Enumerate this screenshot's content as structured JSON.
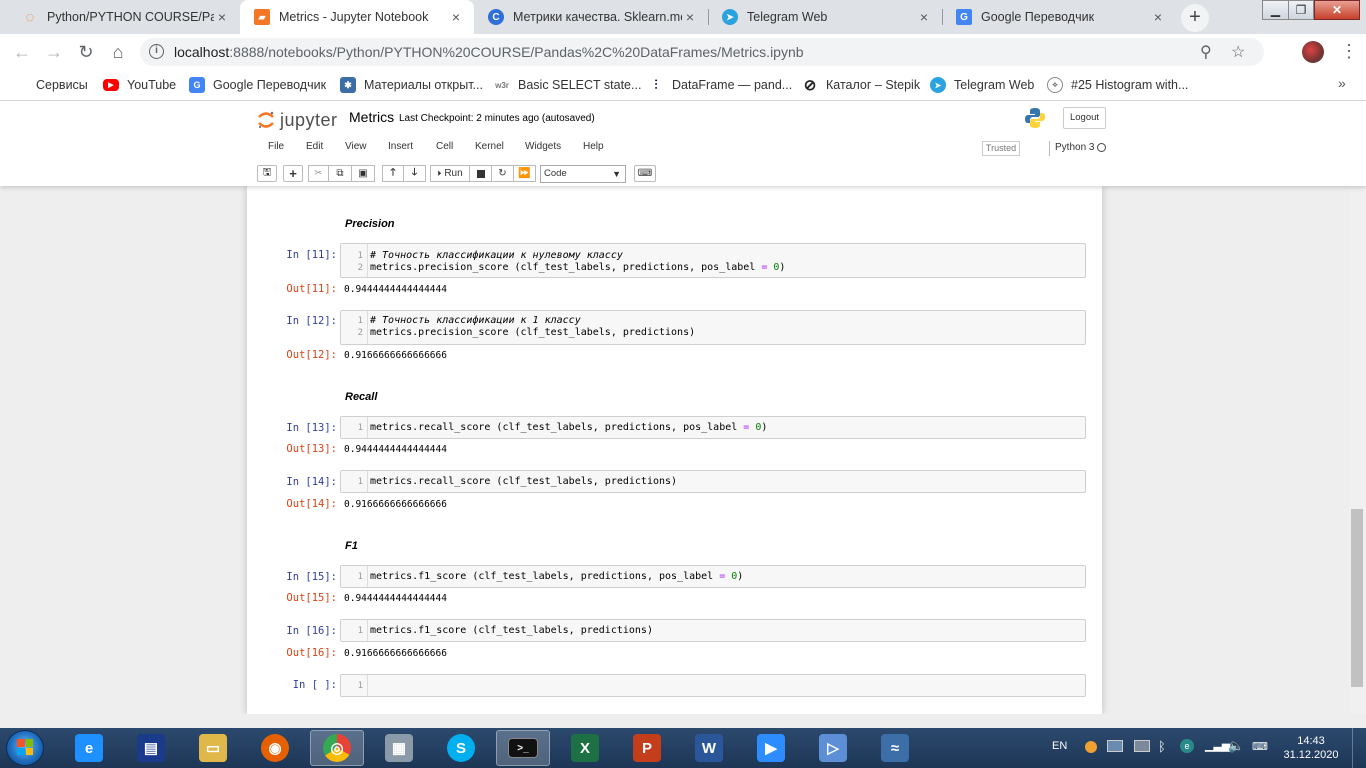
{
  "browser": {
    "tabs": [
      {
        "title": "Python/PYTHON COURSE/Panda",
        "close": "×",
        "fav_color": "#f37726",
        "fav_glyph": "◌"
      },
      {
        "title": "Metrics - Jupyter Notebook",
        "close": "×",
        "fav_color": "#f37726",
        "fav_glyph": "▰"
      },
      {
        "title": "Метрики качества. Sklearn.met",
        "close": "×",
        "fav_color": "#2f6fd6",
        "fav_glyph": "C"
      },
      {
        "title": "Telegram Web",
        "close": "×",
        "fav_color": "#2aa3df",
        "fav_glyph": "➤"
      },
      {
        "title": "Google Переводчик",
        "close": "×",
        "fav_color": "#4285f4",
        "fav_glyph": "G"
      }
    ],
    "new_tab": "+",
    "url_host": "localhost",
    "url_path": ":8888/notebooks/Python/PYTHON%20COURSE/Pandas%2C%20DataFrames/Metrics.ipynb",
    "bookmarks": [
      {
        "label": "Сервисы",
        "icon": "apps-icon",
        "color": "#4285f4"
      },
      {
        "label": "YouTube",
        "icon": "youtube-icon",
        "color": "#ff0000"
      },
      {
        "label": "Google Переводчик",
        "icon": "translate-icon",
        "color": "#4285f4"
      },
      {
        "label": "Материалы открыт...",
        "icon": "ods-icon",
        "color": "#3a6ea5"
      },
      {
        "label": "Basic SELECT state...",
        "icon": "w3r-icon",
        "color": "#777777"
      },
      {
        "label": "DataFrame — pand...",
        "icon": "pandas-icon",
        "color": "#150458"
      },
      {
        "label": "Каталог – Stepik",
        "icon": "stepik-icon",
        "color": "#222222"
      },
      {
        "label": "Telegram Web",
        "icon": "telegram-icon",
        "color": "#2aa3df"
      },
      {
        "label": "#25 Histogram with...",
        "icon": "chart-icon",
        "color": "#666666"
      }
    ],
    "more": "»"
  },
  "jupyter": {
    "logo_text": "jupyter",
    "notebook_name": "Metrics",
    "checkpoint": "Last Checkpoint: 2 minutes ago  (autosaved)",
    "logout": "Logout",
    "menus": [
      "File",
      "Edit",
      "View",
      "Insert",
      "Cell",
      "Kernel",
      "Widgets",
      "Help"
    ],
    "trusted": "Trusted",
    "kernel": "Python 3",
    "run_label": "Run",
    "cell_type": "Code"
  },
  "notebook": {
    "headings": {
      "precision": "Precision",
      "recall": "Recall",
      "f1": "F1"
    },
    "cells": [
      {
        "in": "In [11]:",
        "out": "Out[11]:",
        "line1_comment": "# Точность классификации к нулевому классу",
        "line2_code": "metrics.precision_score (clf_test_labels, predictions, pos_label ",
        "line2_eq": "=",
        "line2_num": " 0",
        "line2_end": ")",
        "result": "0.9444444444444444"
      },
      {
        "in": "In [12]:",
        "out": "Out[12]:",
        "line1_comment": "# Точность классификации к 1 классу",
        "line2_code": "metrics.precision_score (clf_test_labels, predictions)",
        "result": "0.9166666666666666"
      },
      {
        "in": "In [13]:",
        "out": "Out[13]:",
        "line_code": "metrics.recall_score (clf_test_labels, predictions, pos_label ",
        "line_eq": "=",
        "line_num": " 0",
        "line_end": ")",
        "result": "0.9444444444444444"
      },
      {
        "in": "In [14]:",
        "out": "Out[14]:",
        "line_code": "metrics.recall_score (clf_test_labels, predictions)",
        "result": "0.9166666666666666"
      },
      {
        "in": "In [15]:",
        "out": "Out[15]:",
        "line_code": "metrics.f1_score (clf_test_labels, predictions, pos_label ",
        "line_eq": "=",
        "line_num": " 0",
        "line_end": ")",
        "result": "0.9444444444444444"
      },
      {
        "in": "In [16]:",
        "out": "Out[16]:",
        "line_code": "metrics.f1_score (clf_test_labels, predictions)",
        "result": "0.9166666666666666"
      },
      {
        "in": "In [ ]:"
      }
    ],
    "line_numbers": [
      "1",
      "2"
    ]
  },
  "taskbar": {
    "lang": "EN",
    "time": "14:43",
    "date": "31.12.2020",
    "apps": [
      {
        "name": "ie-icon",
        "glyph": "e",
        "color": "#1e90ff"
      },
      {
        "name": "save-icon",
        "glyph": "▤",
        "color": "#1a3b8c"
      },
      {
        "name": "explorer-icon",
        "glyph": "▭",
        "color": "#e0b84a"
      },
      {
        "name": "firefox-icon",
        "glyph": "◉",
        "color": "#e66000"
      },
      {
        "name": "chrome-icon",
        "glyph": "◎",
        "color": "#34a853"
      },
      {
        "name": "calculator-icon",
        "glyph": "▦",
        "color": "#8a9aa8"
      },
      {
        "name": "skype-icon",
        "glyph": "S",
        "color": "#00aff0"
      },
      {
        "name": "cmd-icon",
        "glyph": ">_",
        "color": "#111111"
      },
      {
        "name": "excel-icon",
        "glyph": "X",
        "color": "#1d7044"
      },
      {
        "name": "powerpoint-icon",
        "glyph": "P",
        "color": "#c43e1c"
      },
      {
        "name": "word-icon",
        "glyph": "W",
        "color": "#2b579a"
      },
      {
        "name": "zoom-icon",
        "glyph": "▶",
        "color": "#2d8cff"
      },
      {
        "name": "media-icon",
        "glyph": "▷",
        "color": "#5c8fd6"
      },
      {
        "name": "wireshark-icon",
        "glyph": "≈",
        "color": "#3c6ea8"
      }
    ]
  }
}
